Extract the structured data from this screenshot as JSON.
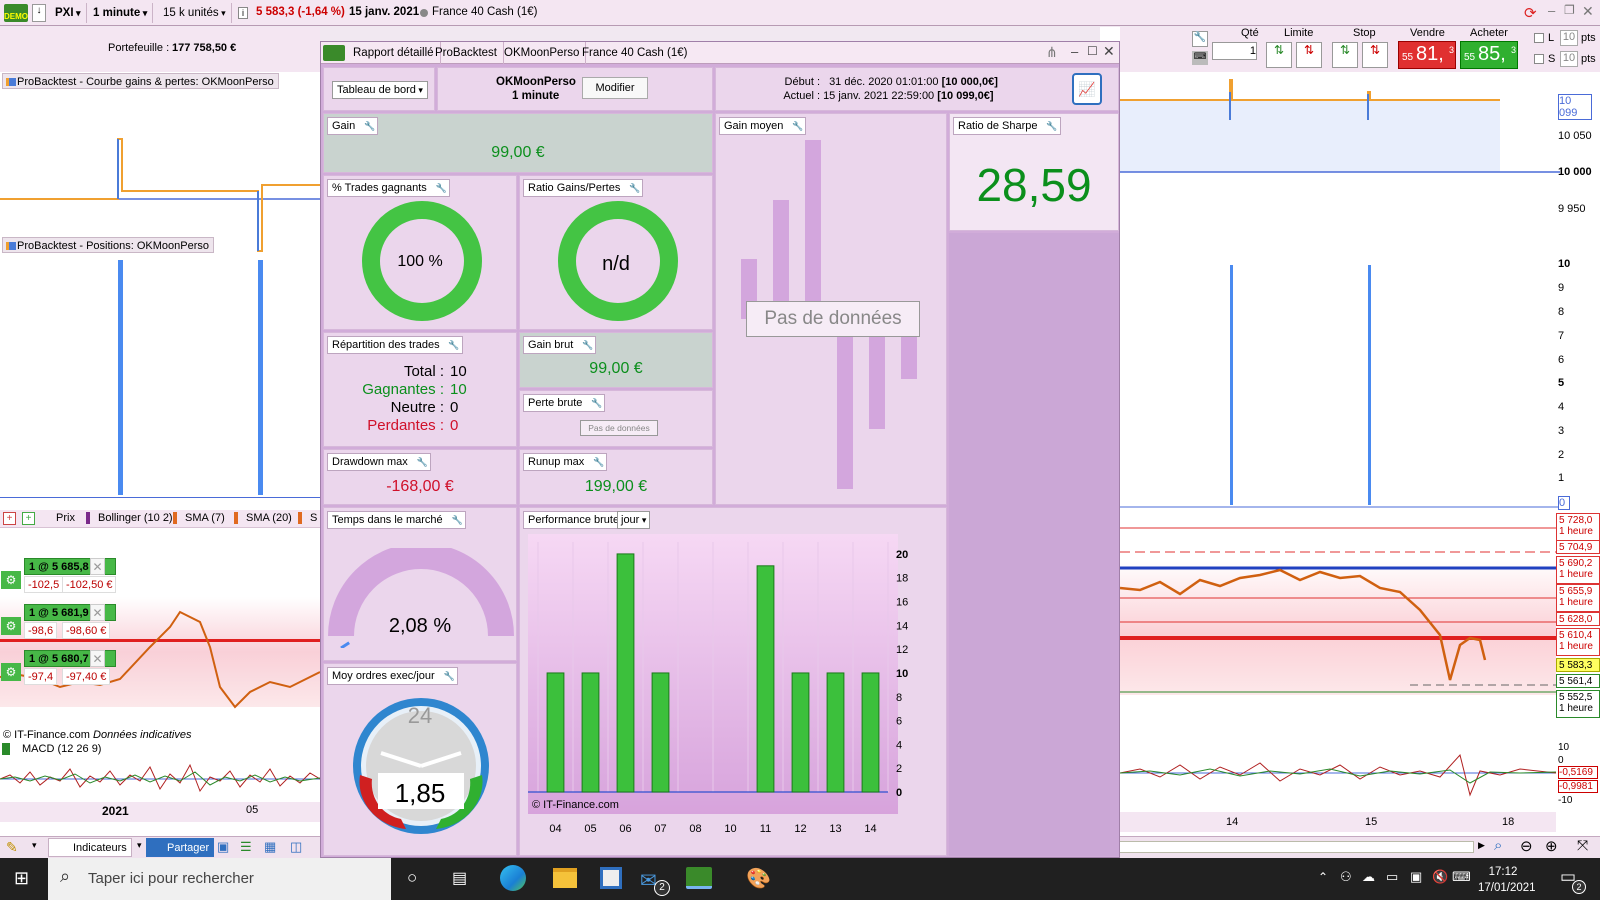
{
  "topbar": {
    "ticker": "PXI",
    "timeframe": "1 minute",
    "units": "15 k unités",
    "price_change": "5 583,3 (-1,64 %)",
    "date": "15 janv. 2021",
    "instrument": "France 40 Cash (1€)",
    "demo_badge": "DEMO"
  },
  "left": {
    "portfolio_label": "Portefeuille :",
    "portfolio_value": "177 758,50 €",
    "panel_equity": "ProBacktest - Courbe gains & pertes: OKMoonPerso",
    "panel_positions": "ProBacktest - Positions: OKMoonPerso",
    "indicators": [
      "Prix",
      "Bollinger (10 2)",
      "SMA (7)",
      "SMA (20)",
      "S"
    ],
    "positions": [
      {
        "order": "1 @ 5 685,8",
        "pts": "-102,5",
        "eur": "-102,50 €"
      },
      {
        "order": "1 @ 5 681,9",
        "pts": "-98,6",
        "eur": "-98,60 €"
      },
      {
        "order": "1 @ 5 680,7",
        "pts": "-97,4",
        "eur": "-97,40 €"
      }
    ],
    "copyright": "© IT-Finance.com",
    "data_note": "Données indicatives",
    "macd": "MACD (12 26 9)",
    "axis_year": "2021",
    "axis_05": "05"
  },
  "order_panel": {
    "qty_label": "Qté",
    "qty_value": "1",
    "limit_label": "Limite",
    "stop_label": "Stop",
    "sell_label": "Vendre",
    "buy_label": "Acheter",
    "sell_price_small": "55",
    "sell_price_big": "81,",
    "sell_price_sup": "3",
    "buy_price_small": "55",
    "buy_price_big": "85,",
    "buy_price_sup": "3",
    "l_label": "L",
    "s_label": "S",
    "pts_value": "10",
    "pts_label": "pts"
  },
  "right": {
    "equity_ticks": [
      "10 099",
      "10 050",
      "10 000",
      "9 950"
    ],
    "position_ticks": [
      "10",
      "9",
      "8",
      "7",
      "6",
      "5",
      "4",
      "3",
      "2",
      "1",
      "0"
    ],
    "price_levels": [
      {
        "price": "5 728,0",
        "tf": "1 heure"
      },
      {
        "price": "5 704,9",
        "tf": ""
      },
      {
        "price": "5 690,2",
        "tf": "1 heure"
      },
      {
        "price": "5 655,9",
        "tf": "1 heure"
      },
      {
        "price": "5 628,0",
        "tf": ""
      },
      {
        "price": "5 610,4",
        "tf": "1 heure"
      },
      {
        "price": "5 583,3",
        "tf": ""
      },
      {
        "price": "5 561,4",
        "tf": "1 heure"
      },
      {
        "price": "5 552,5",
        "tf": "1 heure"
      }
    ],
    "macd_ticks": [
      "10",
      "0",
      "-0,5169",
      "-0,9981",
      "-10"
    ],
    "dates": [
      "14",
      "15",
      "18"
    ]
  },
  "dialog": {
    "tabs": [
      "Rapport détaillé",
      "ProBacktest",
      "OKMoonPerso",
      "France 40 Cash (1€)"
    ],
    "dashboard_select": "Tableau de bord",
    "strategy_name": "OKMoonPerso",
    "strategy_tf": "1 minute",
    "modify_button": "Modifier",
    "start_label": "Début :",
    "start_date": "31 déc. 2020 01:01:00",
    "start_value": "[10 000,0€]",
    "current_label": "Actuel :",
    "current_date": "15 janv. 2021 22:59:00",
    "current_value": "[10 099,0€]",
    "gain_label": "Gain",
    "gain_value": "99,00 €",
    "win_pct_label": "% Trades gagnants",
    "win_pct_value": "100 %",
    "ratio_label": "Ratio Gains/Pertes",
    "ratio_value": "n/d",
    "avg_gain_label": "Gain moyen",
    "no_data": "Pas de données",
    "sharpe_label": "Ratio de Sharpe",
    "sharpe_value": "28,59",
    "distrib_label": "Répartition des trades",
    "total_label": "Total :",
    "total_value": "10",
    "winners_label": "Gagnantes :",
    "winners_value": "10",
    "neutral_label": "Neutre :",
    "neutral_value": "0",
    "losers_label": "Perdantes :",
    "losers_value": "0",
    "gross_gain_label": "Gain brut",
    "gross_gain_value": "99,00 €",
    "gross_loss_label": "Perte brute",
    "gross_loss_nodata": "Pas de données",
    "drawdown_label": "Drawdown max",
    "drawdown_value": "-168,00 €",
    "runup_label": "Runup max",
    "runup_value": "199,00 €",
    "time_label": "Temps dans le marché",
    "time_value": "2,08 %",
    "time_fraction": 0.0208,
    "perf_label": "Performance brute",
    "perf_select": "jour",
    "orders_label": "Moy ordres exec/jour",
    "orders_value": "1,85",
    "clock_value": "24",
    "chart_copyright": "© IT-Finance.com"
  },
  "bottom": {
    "indicators_btn": "Indicateurs",
    "share_btn": "Partager"
  },
  "taskbar": {
    "search_placeholder": "Taper ici pour rechercher",
    "time": "17:12",
    "date": "17/01/2021",
    "mail_badge": "2",
    "notif_badge": "2"
  },
  "chart_data": {
    "type": "bar",
    "categories": [
      "04",
      "05",
      "06",
      "07",
      "08",
      "10",
      "11",
      "12",
      "13",
      "14"
    ],
    "values": [
      10,
      10,
      20,
      10,
      0,
      0,
      19,
      10,
      10,
      10
    ],
    "ylim": [
      0,
      21
    ],
    "yticks": [
      "20",
      "18",
      "16",
      "14",
      "12",
      "10",
      "8",
      "6",
      "4",
      "2",
      "0"
    ],
    "color": "#3cc03c"
  }
}
